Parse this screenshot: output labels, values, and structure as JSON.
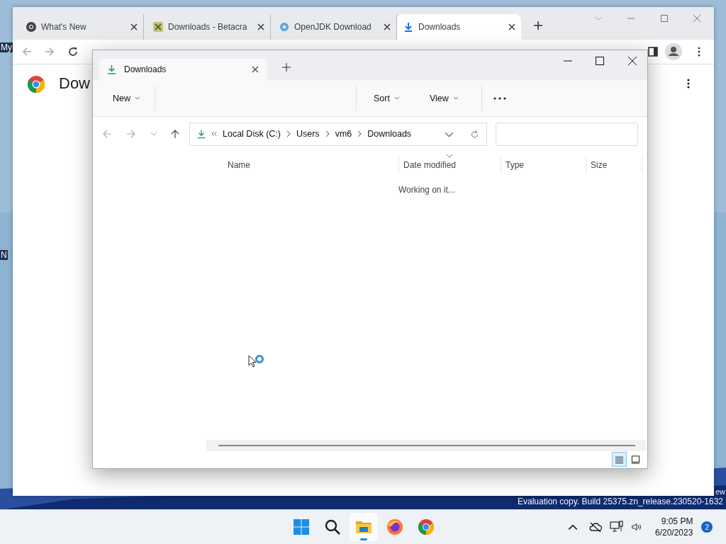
{
  "desktop": {
    "icon_labels": [
      "My",
      "N"
    ],
    "watermark": [
      "ew",
      "Evaluation copy. Build 25375.zn_release.230520-1632"
    ]
  },
  "browser": {
    "tabs": [
      {
        "kind": "chrome",
        "title": "What's New",
        "selected": false
      },
      {
        "kind": "game",
        "title": "Downloads - Betacra",
        "selected": false
      },
      {
        "kind": "globe",
        "title": "OpenJDK Download",
        "selected": false
      },
      {
        "kind": "download",
        "title": "Downloads",
        "selected": true
      }
    ],
    "page_title": "Dow"
  },
  "explorer": {
    "tab": "Downloads",
    "toolbar_left": [
      {
        "label": "New"
      }
    ],
    "toolbar_right": [
      {
        "label": "Sort"
      },
      {
        "label": "View"
      }
    ],
    "path": [
      "Local Disk (C:)",
      "Users",
      "vm6",
      "Downloads"
    ],
    "columns": [
      "Name",
      "Date modified",
      "Type",
      "Size"
    ],
    "status": "Working on it...",
    "views": [
      {
        "kind": "details",
        "selected": true
      },
      {
        "kind": "tiles",
        "selected": false
      }
    ]
  },
  "taskbar": {
    "apps": [
      {
        "kind": "start",
        "active": false
      },
      {
        "kind": "search",
        "active": false
      },
      {
        "kind": "explorer",
        "active": true
      },
      {
        "kind": "firefox",
        "active": false
      },
      {
        "kind": "chrome",
        "active": false
      }
    ],
    "clock": {
      "time": "9:05 PM",
      "date": "6/20/2023"
    },
    "notifications": "2"
  }
}
